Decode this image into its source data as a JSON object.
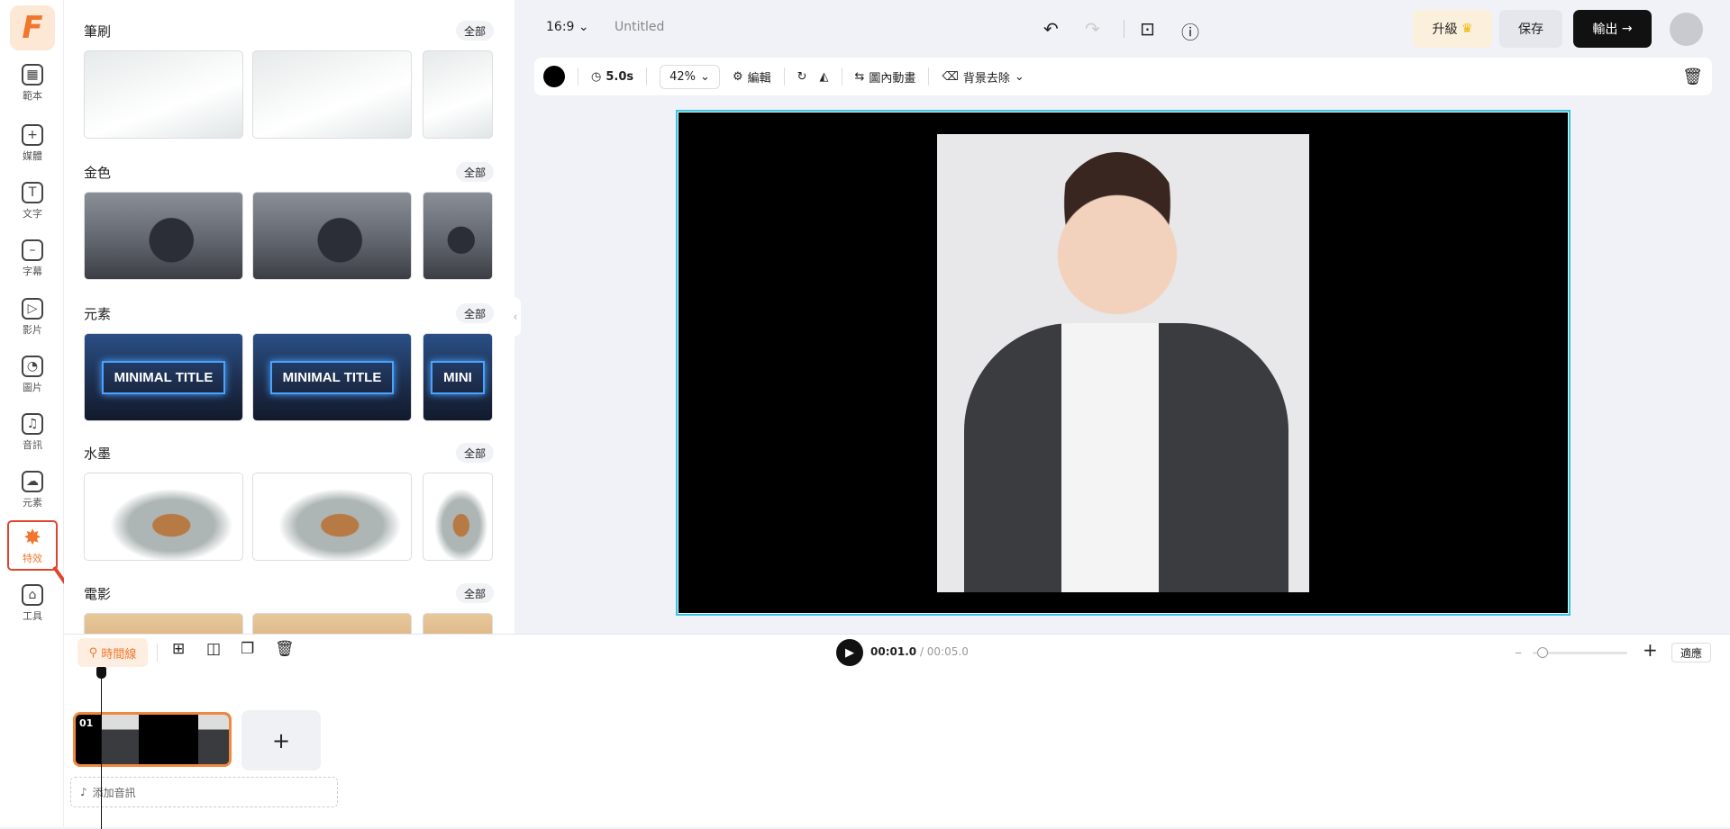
{
  "sidebar": {
    "logo": "F",
    "items": [
      {
        "label": "範本",
        "icon": "template-icon",
        "glyph": "▦"
      },
      {
        "label": "媒體",
        "icon": "folder-plus-icon",
        "glyph": "+"
      },
      {
        "label": "文字",
        "icon": "text-icon",
        "glyph": "T"
      },
      {
        "label": "字幕",
        "icon": "subtitle-icon",
        "glyph": "–"
      },
      {
        "label": "影片",
        "icon": "video-icon",
        "glyph": "▷"
      },
      {
        "label": "圖片",
        "icon": "image-icon",
        "glyph": "◔"
      },
      {
        "label": "音訊",
        "icon": "music-icon",
        "glyph": "♫"
      },
      {
        "label": "元素",
        "icon": "shapes-icon",
        "glyph": "☁"
      },
      {
        "label": "特效",
        "icon": "effects-star-icon",
        "glyph": "✸",
        "active": true
      },
      {
        "label": "工具",
        "icon": "toolbox-icon",
        "glyph": "⌂"
      }
    ]
  },
  "panel": {
    "all_label": "全部",
    "sections": [
      {
        "title": "筆刷",
        "style": "brush"
      },
      {
        "title": "金色",
        "style": "gold"
      },
      {
        "title": "元素",
        "style": "elem",
        "thumb_text": [
          "MINIMAL TITLE",
          "MINIMAL TITLE",
          "MINI"
        ]
      },
      {
        "title": "水墨",
        "style": "ink"
      },
      {
        "title": "電影",
        "style": "film"
      }
    ]
  },
  "header": {
    "ratio": "16:9",
    "title": "Untitled",
    "upgrade": "升級",
    "save": "保存",
    "export": "輸出"
  },
  "toolbar": {
    "color": "#000000",
    "duration": "5.0s",
    "zoom": "42%",
    "edit": "編輯",
    "animation": "圖內動畫",
    "bg_remove": "背景去除"
  },
  "timeline": {
    "tab": "時間線",
    "current": "00:01.0",
    "total": "/ 00:05.0",
    "fit": "適應",
    "clip_number": "01",
    "add_audio": "添加音訊",
    "zoom_level": 0.1
  },
  "colors": {
    "accent": "#f0772e",
    "selection": "#39c6dc"
  }
}
